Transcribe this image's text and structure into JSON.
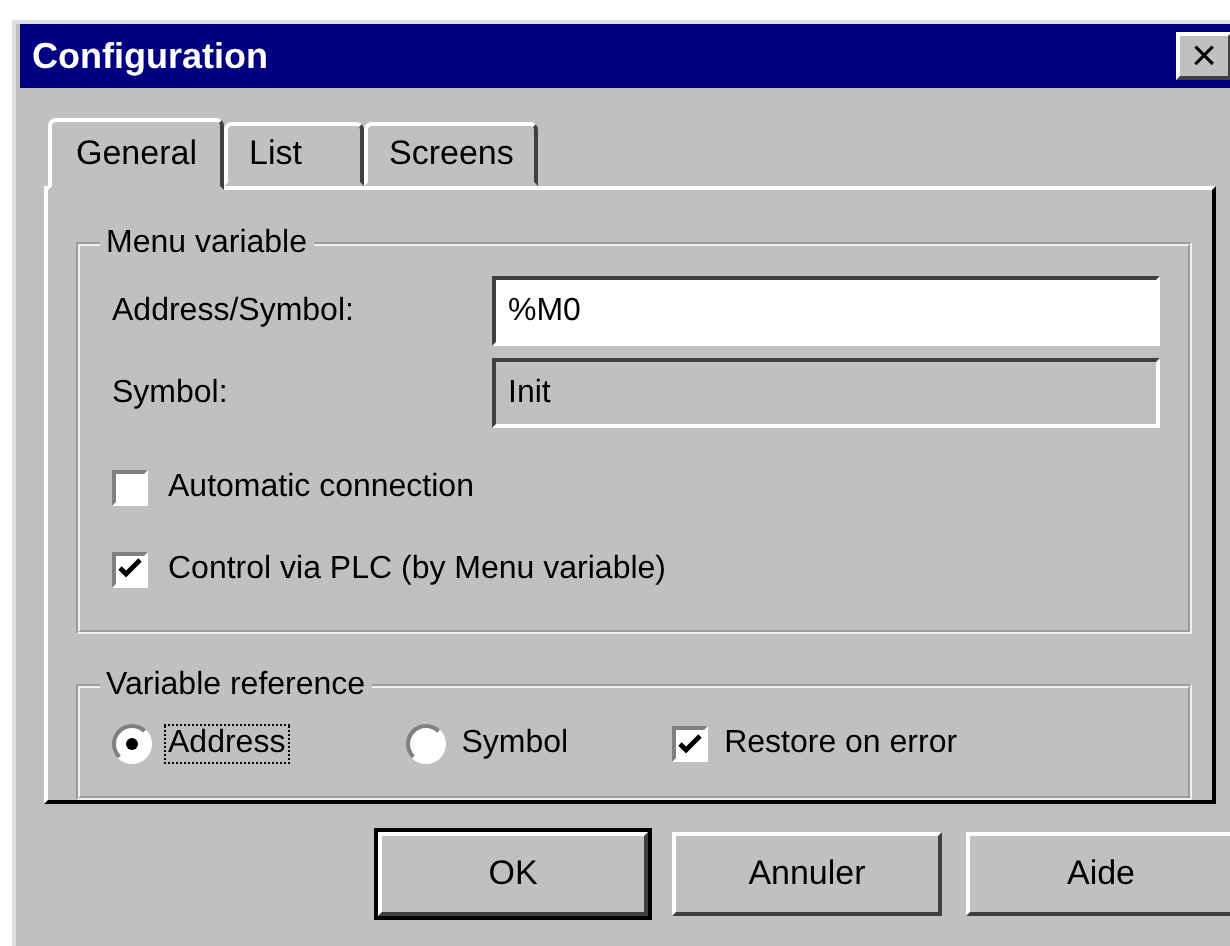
{
  "window": {
    "title": "Configuration",
    "close": "×"
  },
  "tabs": [
    {
      "label": "General",
      "selected": true
    },
    {
      "label": "List",
      "selected": false
    },
    {
      "label": "Screens",
      "selected": false
    }
  ],
  "menu_variable": {
    "title": "Menu variable",
    "fields": [
      {
        "label": "Address/Symbol:",
        "value": "%M0",
        "disabled": false
      },
      {
        "label": "Symbol:",
        "value": "Init",
        "disabled": true
      }
    ],
    "checkboxes": [
      {
        "label": "Automatic connection",
        "checked": false
      },
      {
        "label": "Control via PLC (by Menu variable)",
        "checked": true
      }
    ]
  },
  "variable_reference": {
    "title": "Variable reference",
    "options": [
      {
        "kind": "radio",
        "label": "Address",
        "selected": true,
        "focused": true
      },
      {
        "kind": "radio",
        "label": "Symbol",
        "selected": false,
        "focused": false
      },
      {
        "kind": "checkbox",
        "label": "Restore on error",
        "checked": true,
        "focused": false
      }
    ]
  },
  "buttons": [
    {
      "label": "OK",
      "default": true
    },
    {
      "label": "Annuler",
      "default": false
    },
    {
      "label": "Aide",
      "default": false
    }
  ]
}
